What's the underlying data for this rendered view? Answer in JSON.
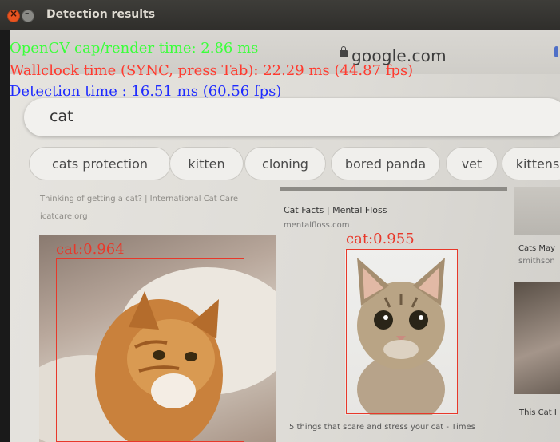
{
  "window": {
    "title": "Detection results",
    "controls": [
      "close",
      "minimize"
    ]
  },
  "overlay": {
    "line1": "OpenCV cap/render time: 2.86 ms",
    "line2": "Wallclock time (SYNC, press Tab): 22.29 ms (44.87 fps)",
    "line3": "Detection time  : 16.51 ms (60.56 fps)",
    "colors": {
      "line1": "#3bff3b",
      "line2": "#ff3b2f",
      "line3": "#1e2bff",
      "bbox": "#e8382a"
    }
  },
  "browser": {
    "url": "google.com",
    "query": "cat",
    "chips": [
      "cats protection",
      "kitten",
      "cloning",
      "bored panda",
      "vet",
      "kittens"
    ],
    "cards": {
      "left_snippet": "Thinking of getting a cat? | International Cat Care",
      "left_source": "icatcare.org",
      "middle_title": "Cat Facts | Mental Floss",
      "middle_source": "mentalfloss.com",
      "right_title": "Cats May",
      "right_source": "smithson",
      "bottom_middle": "5 things that scare and stress your cat - Times",
      "bottom_right": "This Cat I"
    }
  },
  "detections": [
    {
      "label": "cat:0.964"
    },
    {
      "label": "cat:0.955"
    }
  ]
}
